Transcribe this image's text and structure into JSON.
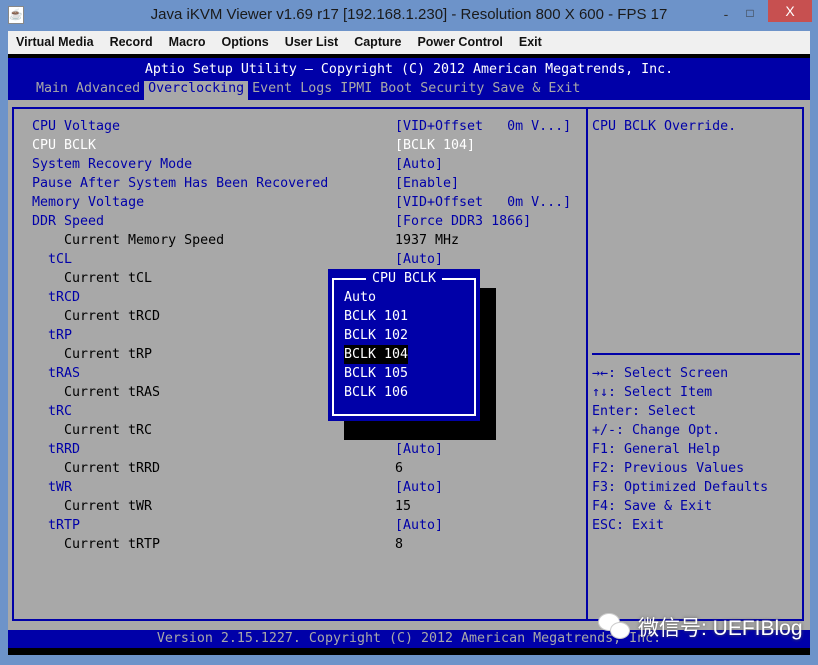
{
  "window": {
    "title": "Java iKVM Viewer v1.69 r17 [192.168.1.230]  - Resolution 800 X 600 - FPS 17",
    "minimize": "-",
    "maximize": "□",
    "close": "X"
  },
  "menubar": [
    "Virtual Media",
    "Record",
    "Macro",
    "Options",
    "User List",
    "Capture",
    "Power Control",
    "Exit"
  ],
  "bios": {
    "header": "Aptio Setup Utility – Copyright (C) 2012 American Megatrends, Inc.",
    "tabs": [
      "Main",
      "Advanced",
      "Overclocking",
      "Event Logs",
      "IPMI",
      "Boot",
      "Security",
      "Save & Exit"
    ],
    "active_tab": "Overclocking",
    "colors": {
      "blue": "#0000a8",
      "gray": "#a8a8a8",
      "white": "#ffffff"
    },
    "rows": [
      {
        "label": "CPU Voltage",
        "value": "[VID+Offset   0m V...]",
        "indent": 0
      },
      {
        "label": "CPU BCLK",
        "value": "[BCLK 104]",
        "indent": 0,
        "selected": true
      },
      {
        "label": "System Recovery Mode",
        "value": "[Auto]",
        "indent": 0
      },
      {
        "label": "Pause After System Has Been Recovered",
        "value": "[Enable]",
        "indent": 0
      },
      {
        "label": "Memory Voltage",
        "value": "[VID+Offset   0m V...]",
        "indent": 0
      },
      {
        "label": "DDR Speed",
        "value": "[Force DDR3 1866]",
        "indent": 0
      },
      {
        "label": "Current Memory Speed",
        "value": "1937 MHz",
        "indent": 2,
        "readonly": true
      },
      {
        "label": "tCL",
        "value": "[Auto]",
        "indent": 1
      },
      {
        "label": "Current tCL",
        "value": "",
        "indent": 2,
        "readonly": true
      },
      {
        "label": "tRCD",
        "value": "",
        "indent": 1
      },
      {
        "label": "Current tRCD",
        "value": "",
        "indent": 2,
        "readonly": true
      },
      {
        "label": "tRP",
        "value": "",
        "indent": 1
      },
      {
        "label": "Current tRP",
        "value": "",
        "indent": 2,
        "readonly": true
      },
      {
        "label": "tRAS",
        "value": "",
        "indent": 1
      },
      {
        "label": "Current tRAS",
        "value": "",
        "indent": 2,
        "readonly": true
      },
      {
        "label": "tRC",
        "value": "",
        "indent": 1
      },
      {
        "label": "Current tRC",
        "value": "",
        "indent": 2,
        "readonly": true
      },
      {
        "label": "tRRD",
        "value": "[Auto]",
        "indent": 1
      },
      {
        "label": "Current tRRD",
        "value": "6",
        "indent": 2,
        "readonly": true
      },
      {
        "label": "tWR",
        "value": "[Auto]",
        "indent": 1
      },
      {
        "label": "Current tWR",
        "value": "15",
        "indent": 2,
        "readonly": true
      },
      {
        "label": "tRTP",
        "value": "[Auto]",
        "indent": 1
      },
      {
        "label": "Current tRTP",
        "value": "8",
        "indent": 2,
        "readonly": true
      }
    ],
    "help_text": "CPU BCLK Override.",
    "keys": [
      "→←: Select Screen",
      "↑↓: Select Item",
      "Enter: Select",
      "+/-: Change Opt.",
      "F1: General Help",
      "F2: Previous Values",
      "F3: Optimized Defaults",
      "F4: Save & Exit",
      "ESC: Exit"
    ],
    "popup": {
      "title": "CPU BCLK",
      "options": [
        "Auto",
        "BCLK 101",
        "BCLK 102",
        "BCLK 104",
        "BCLK 105",
        "BCLK 106"
      ],
      "selected": "BCLK 104"
    },
    "footer": "Version 2.15.1227. Copyright (C) 2012 American Megatrends, Inc."
  },
  "watermark": "微信号: UEFIBlog"
}
